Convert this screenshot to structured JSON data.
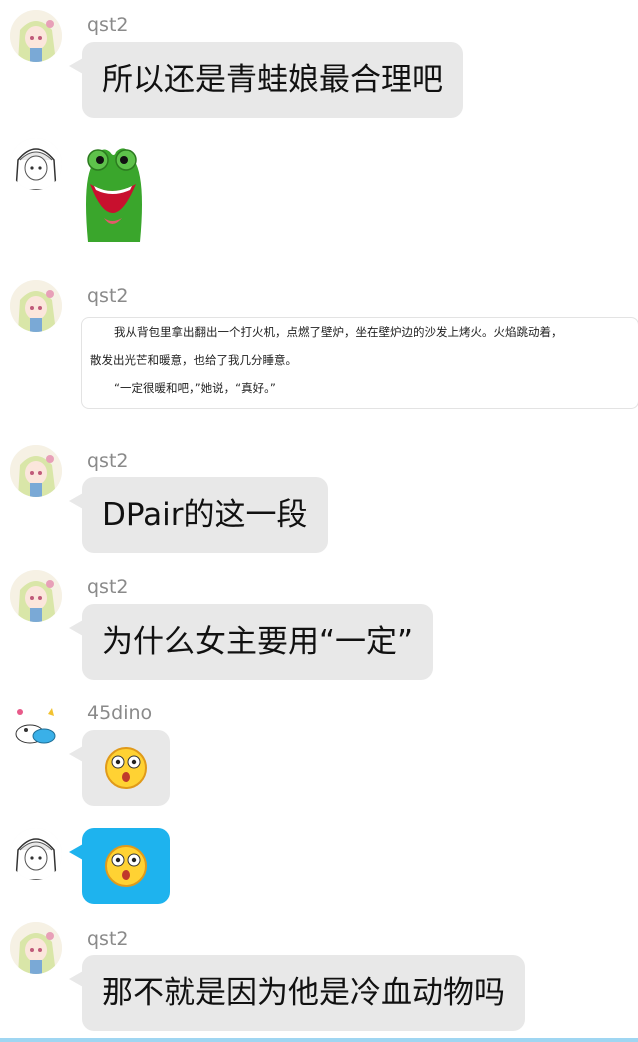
{
  "messages": [
    {
      "sender": "qst2",
      "text": "所以还是青蛙娘最合理吧"
    },
    {
      "sender": "",
      "sticker": "frog-sticker"
    },
    {
      "sender": "qst2",
      "quote_lines": [
        "我从背包里拿出翻出一个打火机，点燃了壁炉，坐在壁炉边的沙发上烤火。火焰跳动着，",
        "散发出光芒和暖意，也给了我几分睡意。",
        "“一定很暖和吧，”她说，“真好。”"
      ]
    },
    {
      "sender": "qst2",
      "text": "DPair的这一段"
    },
    {
      "sender": "qst2",
      "text": "为什么女主要用“一定”"
    },
    {
      "sender": "45dino",
      "emoji": "surprised-face-emoji"
    },
    {
      "sender": "",
      "emoji": "surprised-face-emoji",
      "bubble_color": "#1eb3ee"
    },
    {
      "sender": "qst2",
      "text": "那不就是因为他是冷血动物吗"
    }
  ],
  "colors": {
    "bubble": "#e8e8e8",
    "self_bubble": "#1eb3ee",
    "name": "#8a8a8a"
  }
}
